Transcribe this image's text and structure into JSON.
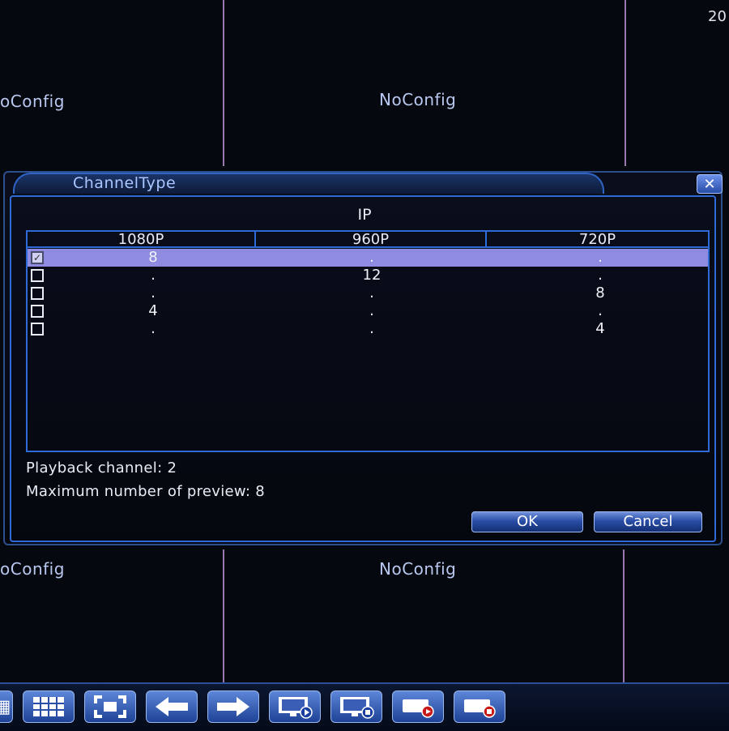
{
  "background": {
    "cells": [
      {
        "label": "oConfig"
      },
      {
        "label": "NoConfig"
      },
      {
        "label": "oConfig"
      },
      {
        "label": "NoConfig"
      }
    ],
    "clock": "20"
  },
  "dialog": {
    "title": "ChannelType",
    "close_icon": "close-icon",
    "group_label": "IP",
    "columns": [
      "1080P",
      "960P",
      "720P"
    ],
    "rows": [
      {
        "checked": true,
        "values": [
          "8",
          ".",
          "."
        ]
      },
      {
        "checked": false,
        "values": [
          ".",
          "12",
          "."
        ]
      },
      {
        "checked": false,
        "values": [
          ".",
          ".",
          "8"
        ]
      },
      {
        "checked": false,
        "values": [
          "4",
          ".",
          "."
        ]
      },
      {
        "checked": false,
        "values": [
          ".",
          ".",
          "4"
        ]
      }
    ],
    "playback": "Playback channel: 2",
    "max_preview": "Maximum number of preview: 8",
    "ok_label": "OK",
    "cancel_label": "Cancel"
  },
  "toolbar": {
    "buttons": [
      {
        "icon": "single-view-icon"
      },
      {
        "icon": "grid-view-icon"
      },
      {
        "icon": "fullscreen-icon"
      },
      {
        "icon": "arrow-left-icon"
      },
      {
        "icon": "arrow-right-icon"
      },
      {
        "icon": "monitor-play-icon"
      },
      {
        "icon": "monitor-stop-icon"
      },
      {
        "icon": "record-icon"
      },
      {
        "icon": "record-stop-icon"
      }
    ]
  },
  "colors": {
    "accent": "#2f6bd8",
    "selected_row": "#8e8be0",
    "grid_line": "#b48ccc"
  }
}
